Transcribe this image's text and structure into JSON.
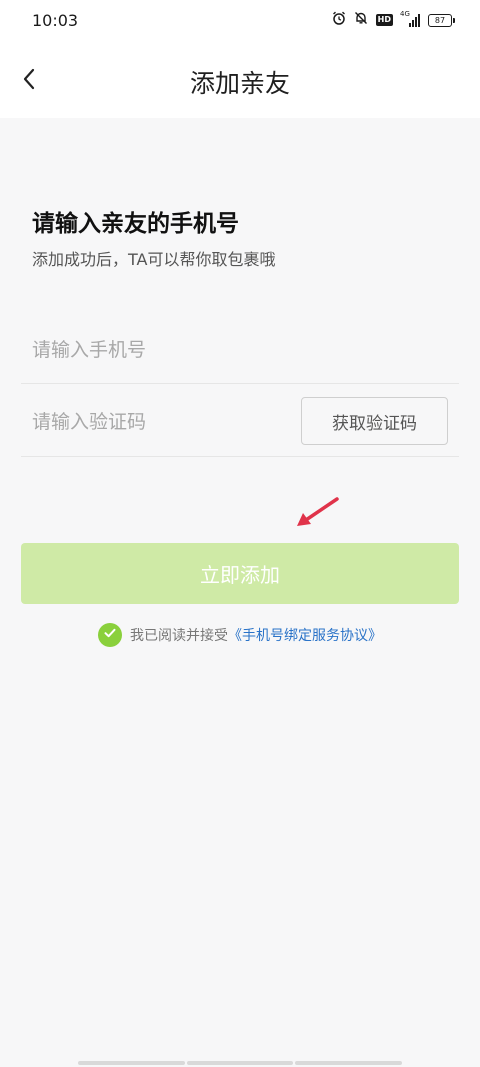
{
  "status_bar": {
    "time": "10:03",
    "hd_label": "HD",
    "network_type": "4G",
    "battery_level": "87"
  },
  "nav": {
    "title": "添加亲友"
  },
  "form": {
    "heading": "请输入亲友的手机号",
    "subheading": "添加成功后，TA可以帮你取包裹哦",
    "phone_placeholder": "请输入手机号",
    "phone_value": "",
    "code_placeholder": "请输入验证码",
    "code_value": "",
    "get_code_label": "获取验证码",
    "submit_label": "立即添加"
  },
  "agreement": {
    "checked": true,
    "text": "我已阅读并接受",
    "link_label": "《手机号绑定服务协议》"
  },
  "colors": {
    "accent_green": "#8ad03c",
    "submit_disabled": "#cfeaa6",
    "link_blue": "#2a73c8",
    "annotation_red": "#e0334a"
  },
  "icons": {
    "back": "chevron-left-icon",
    "alarm": "alarm-icon",
    "bell_muted": "bell-off-icon",
    "check": "check-icon"
  }
}
